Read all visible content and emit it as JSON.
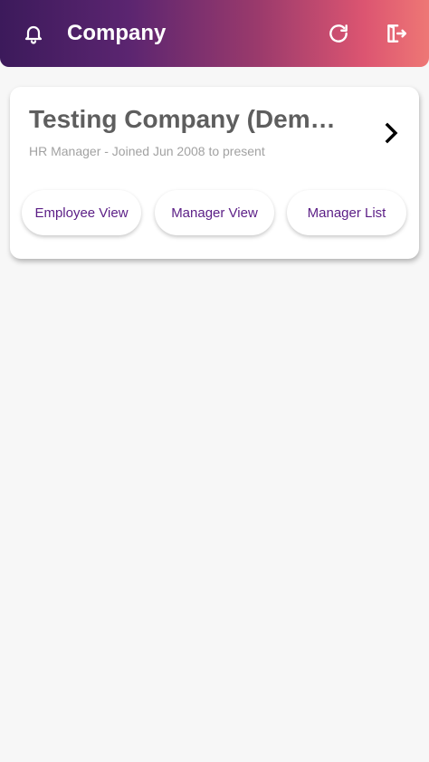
{
  "header": {
    "title": "Company",
    "icons": [
      "bell-icon",
      "refresh-icon",
      "logout-icon"
    ],
    "gradient": [
      "#3c1a5b",
      "#dc5571",
      "#ee7775"
    ]
  },
  "company_card": {
    "name": "Testing Company (Dem…",
    "role_line": "HR Manager - Joined Jun 2008 to present",
    "buttons": [
      {
        "label": "Employee View"
      },
      {
        "label": "Manager View"
      },
      {
        "label": "Manager List"
      }
    ]
  },
  "colors": {
    "accent_text": "#5b1e86",
    "background": "#f7f7f7"
  }
}
